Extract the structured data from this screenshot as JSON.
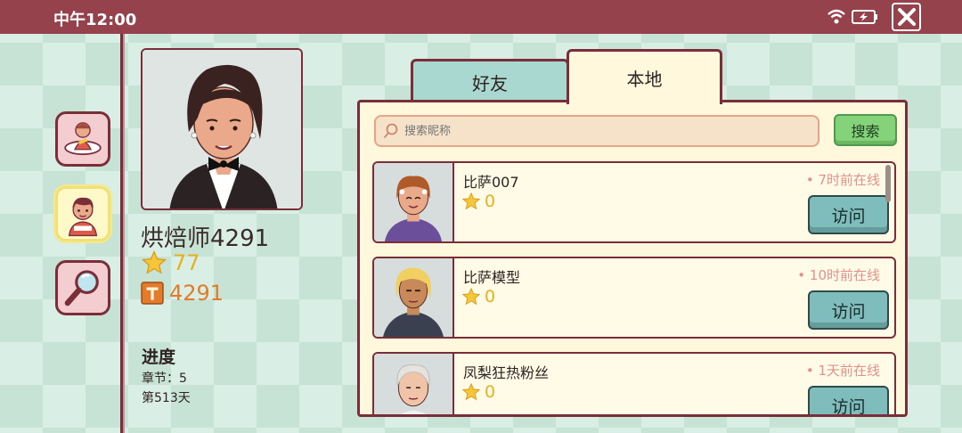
{
  "status_bar": {
    "time": "中午12:00",
    "wifi_icon": "wifi-icon",
    "battery_icon": "battery-charging-icon",
    "close_icon": "close-icon"
  },
  "sidebar": {
    "items": [
      {
        "name": "player-avatar-button",
        "icon": "spinning-character-icon"
      },
      {
        "name": "friends-button",
        "icon": "character-portrait-icon",
        "active": true
      },
      {
        "name": "search-button",
        "icon": "magnifier-icon"
      }
    ]
  },
  "profile": {
    "name": "烘焙师4291",
    "stars": "77",
    "hammers": "4291",
    "progress_title": "进度",
    "chapter_line": "章节：5",
    "day_line": "第513天"
  },
  "tabs": {
    "friends": "好友",
    "local": "本地",
    "active": "local"
  },
  "search": {
    "placeholder": "搜索昵称",
    "button": "搜索"
  },
  "friends": [
    {
      "name": "比萨007",
      "stars": "0",
      "online": "• 7时前在线",
      "visit": "访问"
    },
    {
      "name": "比萨模型",
      "stars": "0",
      "online": "• 10时前在线",
      "visit": "访问"
    },
    {
      "name": "凤梨狂热粉丝",
      "stars": "0",
      "online": "• 1天前在线",
      "visit": "访问"
    }
  ],
  "colors": {
    "status_bar": "#96424c",
    "border": "#7a2e3a",
    "panel_bg": "#fff8dc",
    "visit_button": "#7fbcbc",
    "search_button": "#84d27a",
    "star": "#e8b020",
    "online_text": "#e3908c"
  }
}
